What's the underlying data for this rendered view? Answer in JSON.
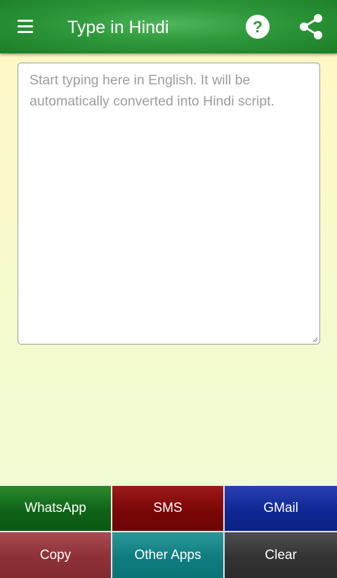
{
  "appbar": {
    "title": "Type in Hindi",
    "menu_icon": "hamburger-menu-icon",
    "help_icon": "help-circle-icon",
    "share_icon": "share-icon",
    "color": "#2f9a3c"
  },
  "editor": {
    "value": "",
    "placeholder": "Start typing here in English. It will be automatically converted into Hindi script."
  },
  "buttons": {
    "whatsapp": "WhatsApp",
    "sms": "SMS",
    "gmail": "GMail",
    "copy": "Copy",
    "other_apps": "Other Apps",
    "clear": "Clear"
  },
  "colors": {
    "whatsapp": "#0f6317",
    "sms": "#7a0707",
    "gmail": "#0e2794",
    "copy": "#8d3137",
    "other_apps": "#0f7d80",
    "clear": "#333333"
  }
}
